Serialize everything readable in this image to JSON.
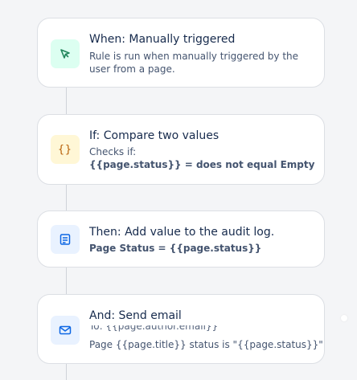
{
  "steps": [
    {
      "title": "When: Manually triggered",
      "lines": [
        "Rule is run when manually triggered by the",
        "user from a page."
      ],
      "icon": "cursor-pointer-icon",
      "icon_bg": "#dcfff1",
      "icon_color": "#1f845a"
    },
    {
      "title": "If: Compare two values",
      "lines": [
        "Checks if:",
        "{{page.status}} = does not equal Empty"
      ],
      "icon": "curly-braces-icon",
      "icon_bg": "#fff7d6",
      "icon_color": "#b65c02"
    },
    {
      "title": "Then: Add value to the audit log.",
      "lines": [
        "Page Status = {{page.status}}"
      ],
      "icon": "document-icon",
      "icon_bg": "#e9f2ff",
      "icon_color": "#0c66e4"
    },
    {
      "title": "And: Send email",
      "partial_line": "To: {{page.author.email}}",
      "lines": [
        "Page {{page.title}} status is \"{{page.status}}\""
      ],
      "icon": "mail-icon",
      "icon_bg": "#e9f2ff",
      "icon_color": "#0c66e4"
    }
  ]
}
